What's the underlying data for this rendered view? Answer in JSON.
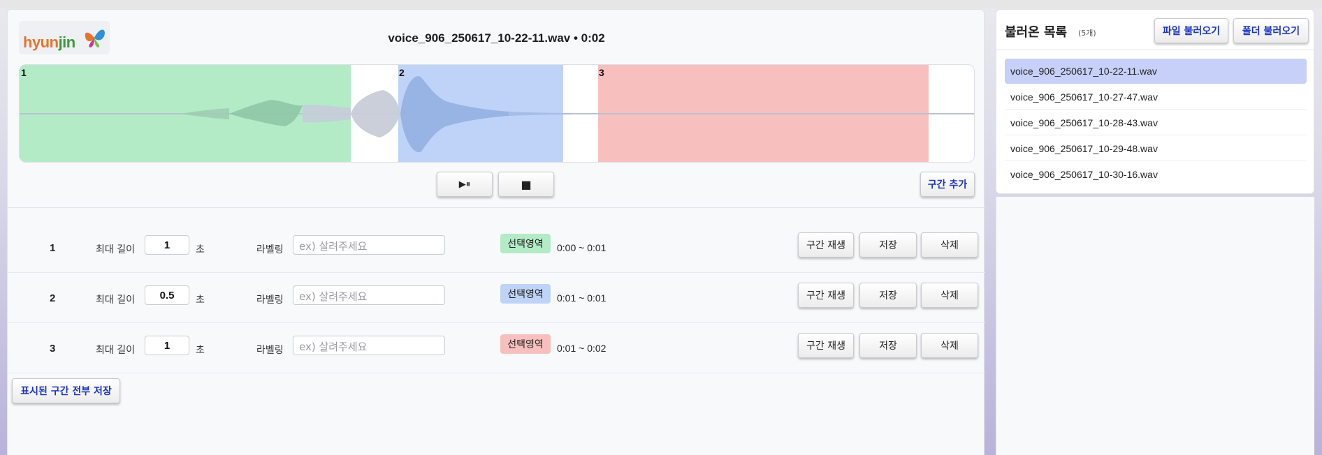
{
  "header": {
    "logo_text_a": "hyun",
    "logo_text_b": "jin",
    "file_title": "voice_906_250617_10-22-11.wav • 0:02"
  },
  "waveform": {
    "region_labels": [
      "1",
      "2",
      "3"
    ],
    "region_colors": [
      "#b3ebc6",
      "#bed3f7",
      "#f7c0be"
    ]
  },
  "controls": {
    "play_pause_label": "▶⏸",
    "stop_label": "■",
    "add_segment_label": "구간 추가"
  },
  "segments": [
    {
      "num": "1",
      "max_len_label": "최대 길이",
      "max_len": "1",
      "unit": "초",
      "label_title": "라벨링",
      "label_placeholder": "ex) 살려주세요",
      "badge": "선택영역",
      "badge_color": "#b3ebc6",
      "range": "0:00 ~ 0:01",
      "play_label": "구간 재생",
      "save_label": "저장",
      "delete_label": "삭제"
    },
    {
      "num": "2",
      "max_len_label": "최대 길이",
      "max_len": "0.5",
      "unit": "초",
      "label_title": "라벨링",
      "label_placeholder": "ex) 살려주세요",
      "badge": "선택영역",
      "badge_color": "#bed3f7",
      "range": "0:01 ~ 0:01",
      "play_label": "구간 재생",
      "save_label": "저장",
      "delete_label": "삭제"
    },
    {
      "num": "3",
      "max_len_label": "최대 길이",
      "max_len": "1",
      "unit": "초",
      "label_title": "라벨링",
      "label_placeholder": "ex) 살려주세요",
      "badge": "선택영역",
      "badge_color": "#f7c0be",
      "range": "0:01 ~ 0:02",
      "play_label": "구간 재생",
      "save_label": "저장",
      "delete_label": "삭제"
    }
  ],
  "save_all_label": "표시된 구간 전부 저장",
  "file_list": {
    "title": "불러온 목록",
    "count": "(5개)",
    "load_file_label": "파일 불러오기",
    "load_folder_label": "폴더 불러오기",
    "items": [
      "voice_906_250617_10-22-11.wav",
      "voice_906_250617_10-27-47.wav",
      "voice_906_250617_10-28-43.wav",
      "voice_906_250617_10-29-48.wav",
      "voice_906_250617_10-30-16.wav"
    ]
  }
}
